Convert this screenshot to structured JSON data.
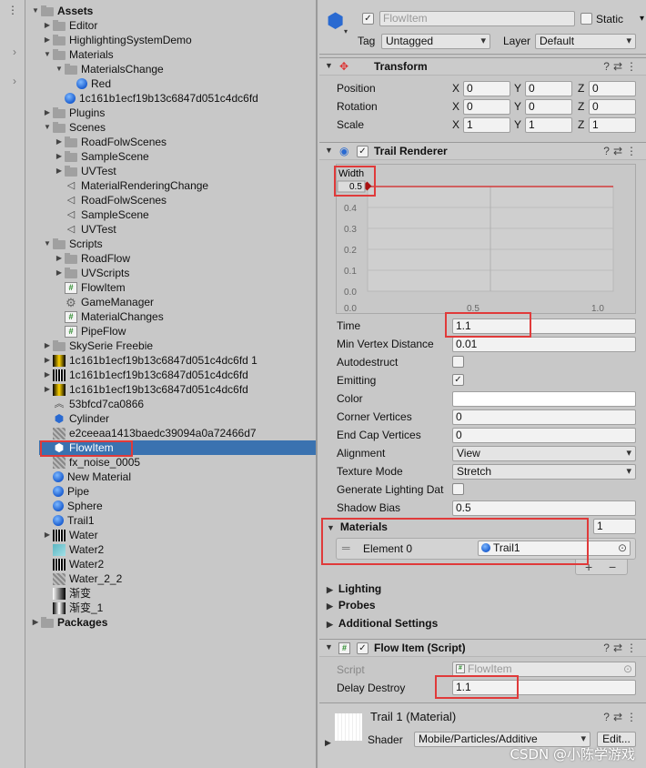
{
  "project": {
    "items": [
      {
        "label": "Assets",
        "depth": 0,
        "fold": "open",
        "icon": "folder",
        "bold": true
      },
      {
        "label": "Editor",
        "depth": 1,
        "fold": "closed",
        "icon": "folder"
      },
      {
        "label": "HighlightingSystemDemo",
        "depth": 1,
        "fold": "closed",
        "icon": "folder"
      },
      {
        "label": "Materials",
        "depth": 1,
        "fold": "open",
        "icon": "folder"
      },
      {
        "label": "MaterialsChange",
        "depth": 2,
        "fold": "open",
        "icon": "folder"
      },
      {
        "label": "Red",
        "depth": 3,
        "fold": "",
        "icon": "sphere"
      },
      {
        "label": "1c161b1ecf19b13c6847d051c4dc6fd",
        "depth": 2,
        "fold": "",
        "icon": "sphere"
      },
      {
        "label": "Plugins",
        "depth": 1,
        "fold": "closed",
        "icon": "folder"
      },
      {
        "label": "Scenes",
        "depth": 1,
        "fold": "open",
        "icon": "folder"
      },
      {
        "label": "RoadFolwScenes",
        "depth": 2,
        "fold": "closed",
        "icon": "folder"
      },
      {
        "label": "SampleScene",
        "depth": 2,
        "fold": "closed",
        "icon": "folder"
      },
      {
        "label": "UVTest",
        "depth": 2,
        "fold": "closed",
        "icon": "folder"
      },
      {
        "label": "MaterialRenderingChange",
        "depth": 2,
        "fold": "",
        "icon": "scene"
      },
      {
        "label": "RoadFolwScenes",
        "depth": 2,
        "fold": "",
        "icon": "scene"
      },
      {
        "label": "SampleScene",
        "depth": 2,
        "fold": "",
        "icon": "scene"
      },
      {
        "label": "UVTest",
        "depth": 2,
        "fold": "",
        "icon": "scene"
      },
      {
        "label": "Scripts",
        "depth": 1,
        "fold": "open",
        "icon": "folder"
      },
      {
        "label": "RoadFlow",
        "depth": 2,
        "fold": "closed",
        "icon": "folder"
      },
      {
        "label": "UVScripts",
        "depth": 2,
        "fold": "closed",
        "icon": "folder"
      },
      {
        "label": "FlowItem",
        "depth": 2,
        "fold": "",
        "icon": "script"
      },
      {
        "label": "GameManager",
        "depth": 2,
        "fold": "",
        "icon": "gear"
      },
      {
        "label": "MaterialChanges",
        "depth": 2,
        "fold": "",
        "icon": "script"
      },
      {
        "label": "PipeFlow",
        "depth": 2,
        "fold": "",
        "icon": "script"
      },
      {
        "label": "SkySerie Freebie",
        "depth": 1,
        "fold": "closed",
        "icon": "folder"
      },
      {
        "label": "1c161b1ecf19b13c6847d051c4dc6fd 1",
        "depth": 1,
        "fold": "closed",
        "icon": "tex-y"
      },
      {
        "label": "1c161b1ecf19b13c6847d051c4dc6fd",
        "depth": 1,
        "fold": "closed",
        "icon": "tex-wave"
      },
      {
        "label": "1c161b1ecf19b13c6847d051c4dc6fd",
        "depth": 1,
        "fold": "closed",
        "icon": "tex-y"
      },
      {
        "label": "53bfcd7ca0866",
        "depth": 1,
        "fold": "",
        "icon": "chev"
      },
      {
        "label": "Cylinder",
        "depth": 1,
        "fold": "",
        "icon": "cube"
      },
      {
        "label": "e2ceeaa1413baedc39094a0a72466d7",
        "depth": 1,
        "fold": "",
        "icon": "tex-noise"
      },
      {
        "label": "FlowItem",
        "depth": 1,
        "fold": "",
        "icon": "cube",
        "selected": true
      },
      {
        "label": "fx_noise_0005",
        "depth": 1,
        "fold": "",
        "icon": "tex-noise"
      },
      {
        "label": "New Material",
        "depth": 1,
        "fold": "",
        "icon": "sphere"
      },
      {
        "label": "Pipe",
        "depth": 1,
        "fold": "",
        "icon": "sphere"
      },
      {
        "label": "Sphere",
        "depth": 1,
        "fold": "",
        "icon": "sphere"
      },
      {
        "label": "Trail1",
        "depth": 1,
        "fold": "",
        "icon": "sphere"
      },
      {
        "label": "Water",
        "depth": 1,
        "fold": "closed",
        "icon": "tex-wave"
      },
      {
        "label": "Water2",
        "depth": 1,
        "fold": "",
        "icon": "tex-water"
      },
      {
        "label": "Water2",
        "depth": 1,
        "fold": "",
        "icon": "tex-wave"
      },
      {
        "label": "Water_2_2",
        "depth": 1,
        "fold": "",
        "icon": "tex-noise"
      },
      {
        "label": "渐变",
        "depth": 1,
        "fold": "",
        "icon": "tex-grad"
      },
      {
        "label": "渐变_1",
        "depth": 1,
        "fold": "",
        "icon": "tex-grad2"
      },
      {
        "label": "Packages",
        "depth": 0,
        "fold": "closed",
        "icon": "folder",
        "bold": true
      }
    ]
  },
  "inspector": {
    "object_name": "FlowItem",
    "static_label": "Static",
    "tag_label": "Tag",
    "tag_value": "Untagged",
    "layer_label": "Layer",
    "layer_value": "Default",
    "transform": {
      "title": "Transform",
      "rows": [
        {
          "label": "Position",
          "x": "0",
          "y": "0",
          "z": "0"
        },
        {
          "label": "Rotation",
          "x": "0",
          "y": "0",
          "z": "0"
        },
        {
          "label": "Scale",
          "x": "1",
          "y": "1",
          "z": "1"
        }
      ],
      "axis": [
        "X",
        "Y",
        "Z"
      ]
    },
    "trail": {
      "title": "Trail Renderer",
      "width_label": "Width",
      "width_value": "0.5",
      "y_ticks": [
        "0.4",
        "0.3",
        "0.2",
        "0.1",
        "0.0"
      ],
      "x_ticks": [
        "0.0",
        "0.5",
        "1.0"
      ],
      "time_label": "Time",
      "time_value": "1.1",
      "min_vertex_label": "Min Vertex Distance",
      "min_vertex_value": "0.01",
      "autodestruct_label": "Autodestruct",
      "emitting_label": "Emitting",
      "color_label": "Color",
      "corner_label": "Corner Vertices",
      "corner_value": "0",
      "endcap_label": "End Cap Vertices",
      "endcap_value": "0",
      "alignment_label": "Alignment",
      "alignment_value": "View",
      "texture_mode_label": "Texture Mode",
      "texture_mode_value": "Stretch",
      "gen_lighting_label": "Generate Lighting Dat",
      "shadow_bias_label": "Shadow Bias",
      "shadow_bias_value": "0.5",
      "materials_label": "Materials",
      "materials_count": "1",
      "element_label": "Element 0",
      "element_value": "Trail1",
      "plus": "+",
      "minus": "−",
      "lighting_label": "Lighting",
      "probes_label": "Probes",
      "additional_label": "Additional Settings"
    },
    "flow_item": {
      "title": "Flow Item (Script)",
      "script_label": "Script",
      "script_value": "FlowItem",
      "delay_label": "Delay Destroy",
      "delay_value": "1.1"
    },
    "material": {
      "title": "Trail 1 (Material)",
      "shader_label": "Shader",
      "shader_value": "Mobile/Particles/Additive",
      "edit_label": "Edit..."
    },
    "watermark": "CSDN @小陈学游戏"
  },
  "colors": {
    "selection": "#3a72b0",
    "highlight_box": "#e03a3a",
    "curve": "#d23b3b"
  }
}
